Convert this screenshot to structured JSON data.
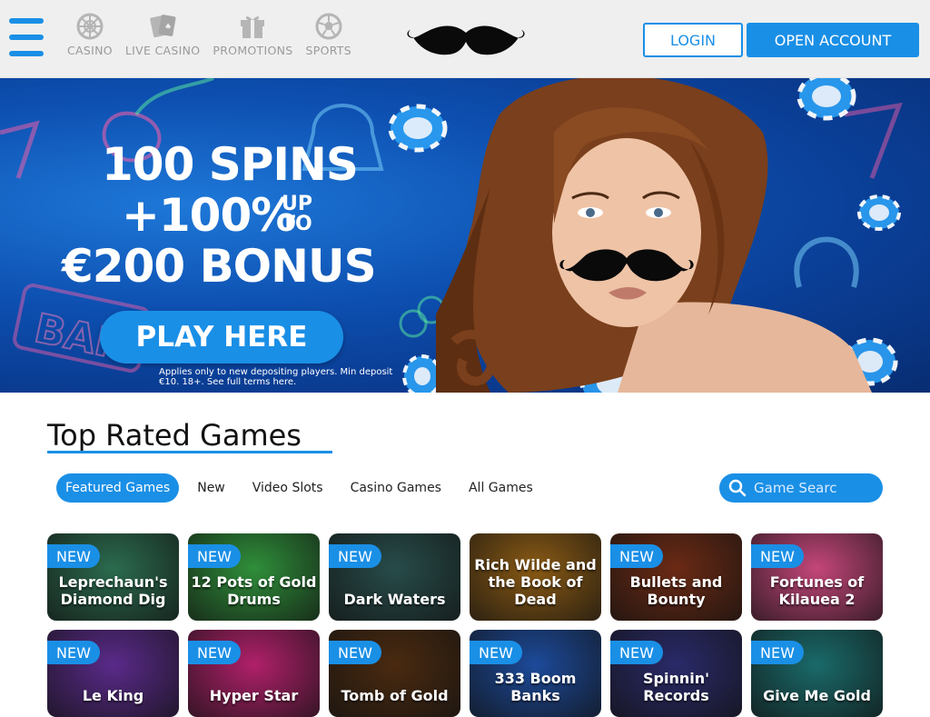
{
  "header": {
    "menu_icon": "hamburger-menu-icon",
    "nav": [
      {
        "label": "CASINO",
        "icon": "roulette-wheel-icon"
      },
      {
        "label": "LIVE CASINO",
        "icon": "playing-cards-icon"
      },
      {
        "label": "PROMOTIONS",
        "icon": "gift-box-icon"
      },
      {
        "label": "SPORTS",
        "icon": "soccer-ball-icon"
      }
    ],
    "logo": "mustache-logo",
    "login_label": "LOGIN",
    "open_account_label": "OPEN ACCOUNT"
  },
  "hero": {
    "line1": "100 SPINS",
    "line2": "+100%",
    "up_to_1": "UP",
    "up_to_2": "TO",
    "line3": "€200 BONUS",
    "cta_label": "PLAY HERE",
    "terms": "Applies only to new depositing players. Min deposit €10. 18+. See full terms here."
  },
  "games_section": {
    "title": "Top Rated Games",
    "tabs": [
      "Featured Games",
      "New",
      "Video Slots",
      "Casino Games",
      "All Games"
    ],
    "active_tab": "Featured Games",
    "search_placeholder": "Game Searc"
  },
  "games": [
    {
      "title": "Leprechaun's Diamond Dig",
      "badge": "NEW",
      "color": "#2b6b4e"
    },
    {
      "title": "12 Pots of Gold Drums",
      "badge": "NEW",
      "color": "#2f8f3a"
    },
    {
      "title": "Dark Waters",
      "badge": "NEW",
      "color": "#274c4a"
    },
    {
      "title": "Rich Wilde and the Book of Dead",
      "badge": "",
      "color": "#8a5a14"
    },
    {
      "title": "Bullets and Bounty",
      "badge": "NEW",
      "color": "#6b2a14"
    },
    {
      "title": "Fortunes of Kilauea 2",
      "badge": "NEW",
      "color": "#c4467a"
    },
    {
      "title": "Le King",
      "badge": "NEW",
      "color": "#5a2a8a"
    },
    {
      "title": "Hyper Star",
      "badge": "NEW",
      "color": "#b0206a"
    },
    {
      "title": "Tomb of Gold",
      "badge": "NEW",
      "color": "#4a2a10"
    },
    {
      "title": "333 Boom Banks",
      "badge": "NEW",
      "color": "#1c4a9a"
    },
    {
      "title": "Spinnin' Records",
      "badge": "NEW",
      "color": "#2a2a6a"
    },
    {
      "title": "Give Me Gold",
      "badge": "NEW",
      "color": "#1a6a6a"
    }
  ]
}
